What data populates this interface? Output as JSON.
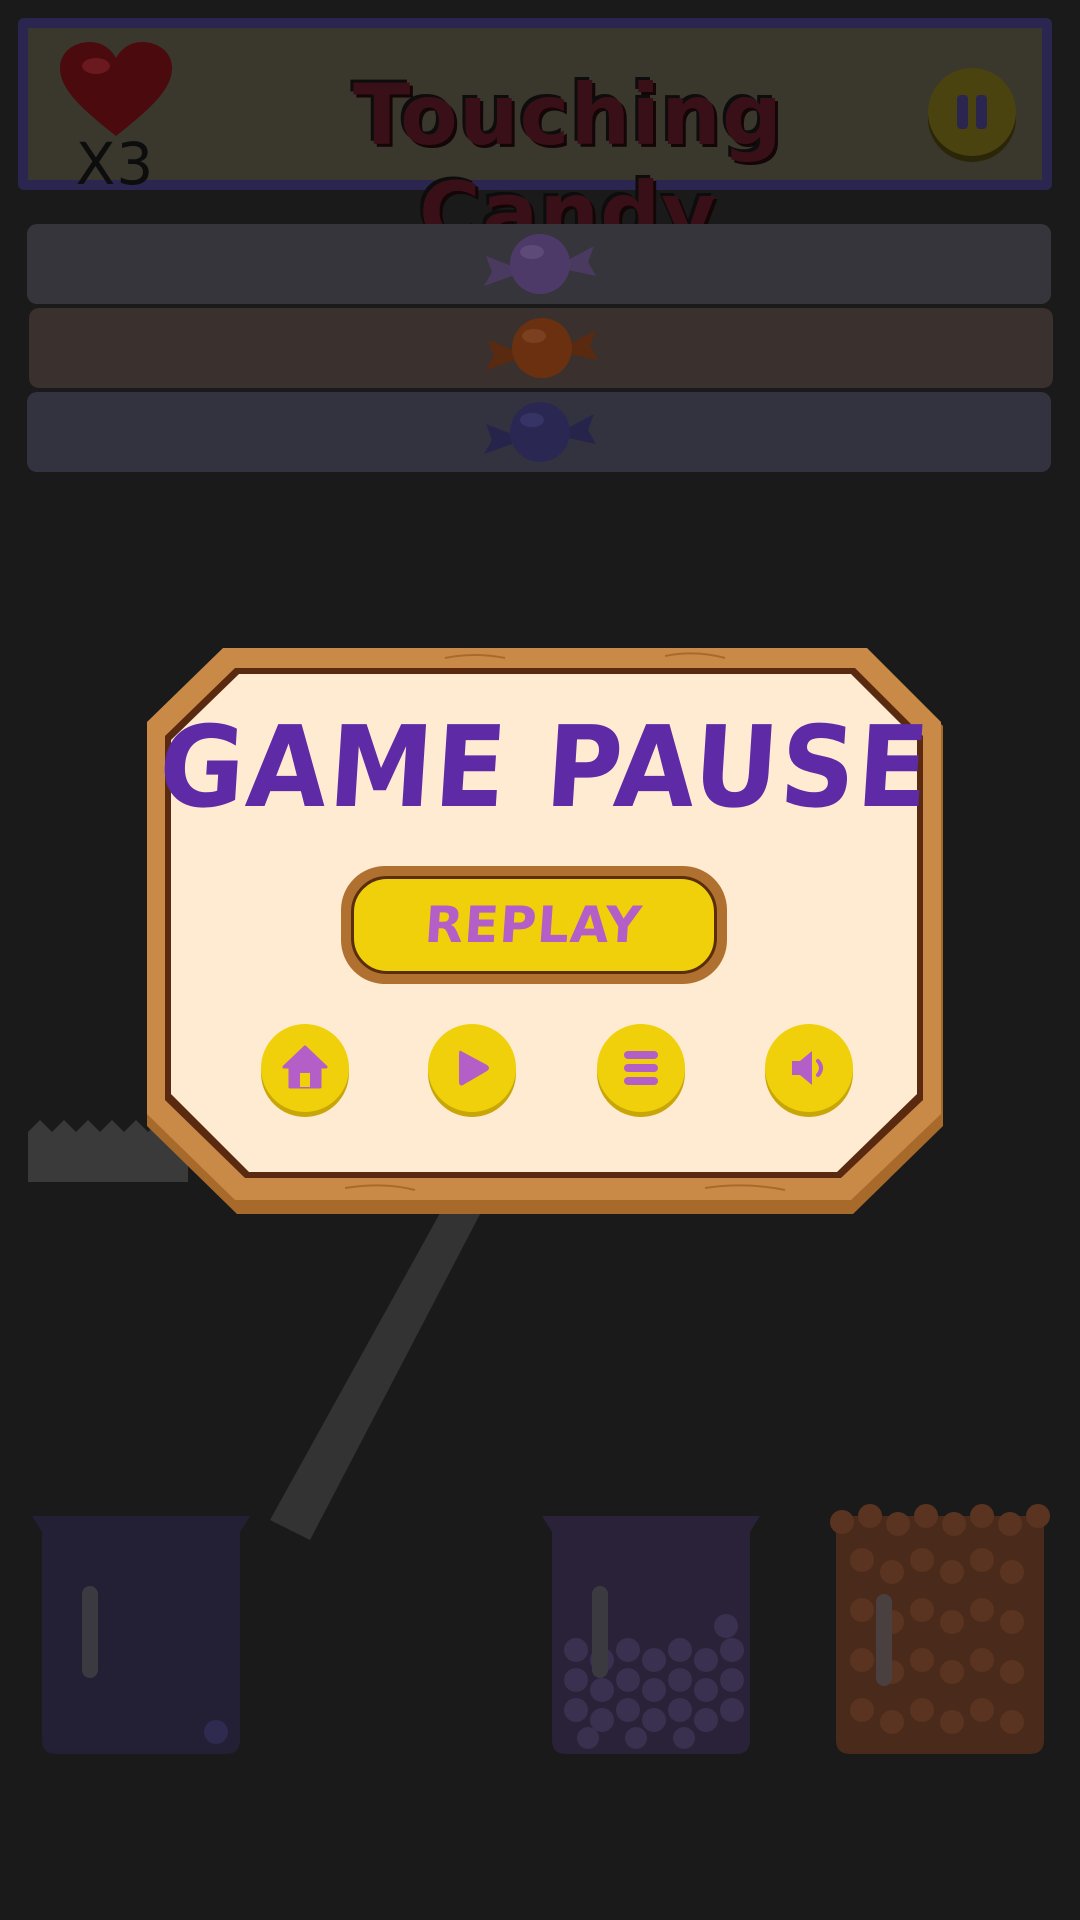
{
  "header": {
    "lives": "X3",
    "title": "Touching Candy",
    "pause_icon": "pause-icon"
  },
  "lanes": [
    {
      "candy": "purple-candy-icon",
      "color": "#6a4a8a"
    },
    {
      "candy": "orange-candy-icon",
      "color": "#b85a1a"
    },
    {
      "candy": "blue-candy-icon",
      "color": "#4a4a9a"
    }
  ],
  "jars": [
    {
      "fill": "empty",
      "color": "#232036"
    },
    {
      "fill": "purple candies",
      "color": "#2a2238"
    },
    {
      "fill": "orange candies",
      "color": "#4a2a1a"
    }
  ],
  "dialog": {
    "title": "GAME PAUSE",
    "replay_label": "REPLAY",
    "buttons": [
      {
        "name": "home-button",
        "icon": "home-icon"
      },
      {
        "name": "resume-button",
        "icon": "play-icon"
      },
      {
        "name": "menu-button",
        "icon": "menu-icon"
      },
      {
        "name": "sound-button",
        "icon": "speaker-icon"
      }
    ],
    "colors": {
      "frame": "#c98a48",
      "panel": "#ffebd2",
      "title": "#5e2aa6",
      "button": "#f0d00a",
      "icon": "#b45ec8"
    }
  }
}
